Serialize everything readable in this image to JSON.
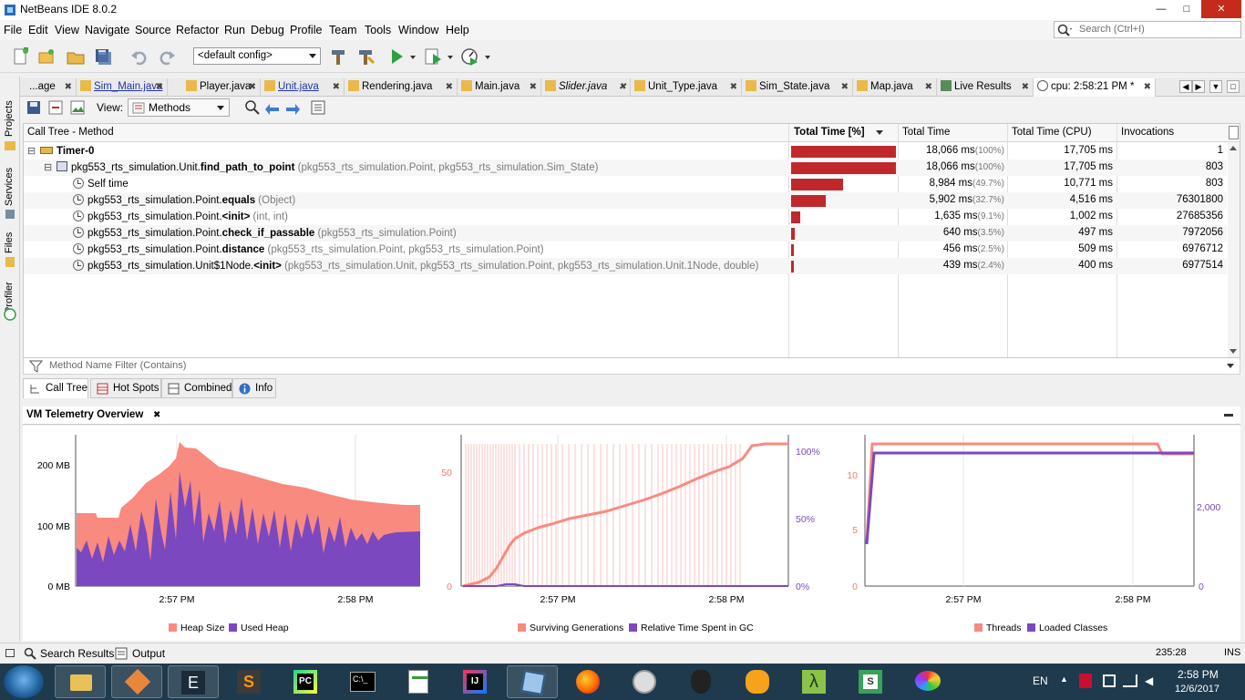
{
  "window": {
    "title": "NetBeans IDE 8.0.2",
    "min_label": "—",
    "max_label": "□",
    "close_label": "✕"
  },
  "menu": [
    "File",
    "Edit",
    "View",
    "Navigate",
    "Source",
    "Refactor",
    "Run",
    "Debug",
    "Profile",
    "Team",
    "Tools",
    "Window",
    "Help"
  ],
  "search": {
    "placeholder": "Search (Ctrl+I)"
  },
  "toolbar": {
    "config": "<default config>"
  },
  "side_tabs": [
    "Projects",
    "Services",
    "Files",
    "Profiler"
  ],
  "tabs": [
    {
      "label": "...age",
      "modified": false
    },
    {
      "label": "Sim_Main.java",
      "modified": true
    },
    {
      "label": "Player.java",
      "modified": false
    },
    {
      "label": "Unit.java",
      "modified": true
    },
    {
      "label": "Rendering.java",
      "modified": false
    },
    {
      "label": "Main.java",
      "modified": false
    },
    {
      "label": "Slider.java",
      "modified": false,
      "italic": true
    },
    {
      "label": "Unit_Type.java",
      "modified": false
    },
    {
      "label": "Sim_State.java",
      "modified": false
    },
    {
      "label": "Map.java",
      "modified": false
    },
    {
      "label": "Live Results",
      "modified": false
    },
    {
      "label": "cpu: 2:58:21 PM *",
      "modified": false
    }
  ],
  "profiler": {
    "view_label": "View:",
    "view_value": "Methods",
    "columns": [
      "Call Tree - Method",
      "Total Time [%]",
      "Total Time",
      "Total Time (CPU)",
      "Invocations"
    ],
    "rows": [
      {
        "name_pre": "",
        "name_bold": "Timer-0",
        "sig": "",
        "level": 0,
        "kind": "thread",
        "pct_value": 100,
        "time": "18,066 ms",
        "pct": "(100%)",
        "cpu": "17,705 ms",
        "inv": "1"
      },
      {
        "name_pre": "pkg553_rts_simulation.Unit.",
        "name_bold": "find_path_to_point",
        "sig": " (pkg553_rts_simulation.Point, pkg553_rts_simulation.Sim_State)",
        "level": 1,
        "kind": "method",
        "pct_value": 100,
        "time": "18,066 ms",
        "pct": "(100%)",
        "cpu": "17,705 ms",
        "inv": "803"
      },
      {
        "name_pre": "Self time",
        "name_bold": "",
        "sig": "",
        "level": 2,
        "kind": "leaf",
        "pct_value": 49.7,
        "time": "8,984 ms",
        "pct": "(49.7%)",
        "cpu": "10,771 ms",
        "inv": "803"
      },
      {
        "name_pre": "pkg553_rts_simulation.Point.",
        "name_bold": "equals",
        "sig": " (Object)",
        "level": 2,
        "kind": "leaf",
        "pct_value": 32.7,
        "time": "5,902 ms",
        "pct": "(32.7%)",
        "cpu": "4,516 ms",
        "inv": "76301800"
      },
      {
        "name_pre": "pkg553_rts_simulation.Point.",
        "name_bold": "<init>",
        "sig": " (int, int)",
        "level": 2,
        "kind": "leaf",
        "pct_value": 9.1,
        "time": "1,635 ms",
        "pct": "(9.1%)",
        "cpu": "1,002 ms",
        "inv": "27685356"
      },
      {
        "name_pre": "pkg553_rts_simulation.Point.",
        "name_bold": "check_if_passable",
        "sig": " (pkg553_rts_simulation.Point)",
        "level": 2,
        "kind": "leaf",
        "pct_value": 3.5,
        "time": "640 ms",
        "pct": "(3.5%)",
        "cpu": "497 ms",
        "inv": "7972056"
      },
      {
        "name_pre": "pkg553_rts_simulation.Point.",
        "name_bold": "distance",
        "sig": " (pkg553_rts_simulation.Point, pkg553_rts_simulation.Point)",
        "level": 2,
        "kind": "leaf",
        "pct_value": 2.5,
        "time": "456 ms",
        "pct": "(2.5%)",
        "cpu": "509 ms",
        "inv": "6976712"
      },
      {
        "name_pre": "pkg553_rts_simulation.Unit$1Node.",
        "name_bold": "<init>",
        "sig": " (pkg553_rts_simulation.Unit, pkg553_rts_simulation.Point, pkg553_rts_simulation.Unit.1Node, double)",
        "level": 2,
        "kind": "leaf",
        "pct_value": 2.4,
        "time": "439 ms",
        "pct": "(2.4%)",
        "cpu": "400 ms",
        "inv": "6977514"
      }
    ],
    "filter_placeholder": "Method Name Filter (Contains)",
    "bottom_tabs": [
      "Call Tree",
      "Hot Spots",
      "Combined",
      "Info"
    ]
  },
  "telemetry": {
    "title": "VM Telemetry Overview",
    "heap": {
      "y_ticks": [
        "200 MB",
        "100 MB",
        "0 MB"
      ],
      "x_ticks": [
        "2:57 PM",
        "2:58 PM"
      ],
      "legend": [
        "Heap Size",
        "Used Heap"
      ],
      "colors": [
        "#f88a80",
        "#7b48c0"
      ]
    },
    "gc": {
      "left_ticks": [
        "50",
        "0"
      ],
      "right_ticks": [
        "100%",
        "50%",
        "0%"
      ],
      "x_ticks": [
        "2:57 PM",
        "2:58 PM"
      ],
      "legend": [
        "Surviving Generations",
        "Relative Time Spent in GC"
      ],
      "colors": [
        "#f88a80",
        "#7b48c0"
      ]
    },
    "threads": {
      "left_ticks": [
        "10",
        "5",
        "0"
      ],
      "right_ticks": [
        "2,000",
        "0"
      ],
      "x_ticks": [
        "2:57 PM",
        "2:58 PM"
      ],
      "legend": [
        "Threads",
        "Loaded Classes"
      ],
      "colors": [
        "#f88a80",
        "#7b48c0"
      ]
    }
  },
  "status": {
    "search_results": "Search Results",
    "output": "Output",
    "position": "235:28",
    "mode": "INS"
  },
  "taskbar": {
    "lang": "EN",
    "time": "2:58 PM",
    "date": "12/6/2017"
  }
}
